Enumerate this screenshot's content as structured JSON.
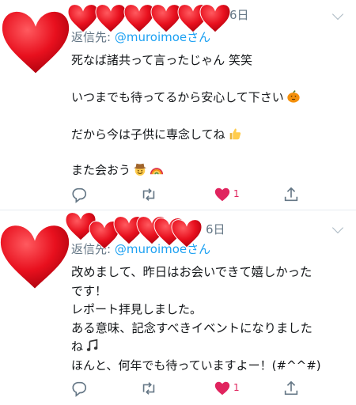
{
  "tweets": [
    {
      "date": "6日",
      "reply_prefix": "返信先: ",
      "reply_handle": "@muroimoe",
      "reply_suffix": "さん",
      "lines": [
        "死なば諸共って言ったじゃん 笑笑",
        "いつまでも待ってるから安心して下さい",
        "だから今は子供に専念してね",
        "また会おう"
      ],
      "like_count": "1"
    },
    {
      "date": "6日",
      "reply_prefix": "返信先: ",
      "reply_handle": "@muroimoe",
      "reply_suffix": "さん",
      "lines": [
        "改めまして、昨日はお会いできて嬉しかった",
        "です！",
        "レポート拝見しました。",
        "ある意味、記念すべきイベントになりました",
        "ね",
        "ほんと、何年でも待っていますよー！(#^^#)"
      ],
      "like_count": "1"
    }
  ],
  "icons": {
    "reply": "reply-icon",
    "retweet": "retweet-icon",
    "like": "heart-icon",
    "share": "share-icon",
    "emoji": [
      "pumpkin-icon",
      "thumbs-up-icon",
      "cowboy-icon",
      "rainbow-icon",
      "music-notes-icon"
    ]
  },
  "colors": {
    "mention": "#1da1f2",
    "meta": "#657786",
    "like": "#e0245e",
    "sticker_heart": "#e8101e"
  }
}
